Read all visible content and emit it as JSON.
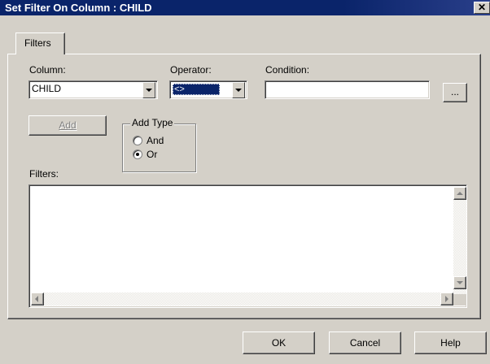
{
  "window": {
    "title": "Set Filter On Column : CHILD",
    "close_glyph": "✕"
  },
  "tabs": [
    {
      "label": "Filters",
      "selected": true
    }
  ],
  "column": {
    "label": "Column:",
    "value": "CHILD"
  },
  "operator": {
    "label": "Operator:",
    "value": "<>"
  },
  "condition": {
    "label": "Condition:",
    "value": "",
    "browse_label": "..."
  },
  "add_button": {
    "label": "Add",
    "enabled": false
  },
  "add_type": {
    "legend": "Add Type",
    "options": [
      {
        "label": "And",
        "checked": false
      },
      {
        "label": "Or",
        "checked": true
      }
    ]
  },
  "filters": {
    "label": "Filters:",
    "items": []
  },
  "footer": {
    "ok_label": "OK",
    "cancel_label": "Cancel",
    "help_label": "Help"
  }
}
